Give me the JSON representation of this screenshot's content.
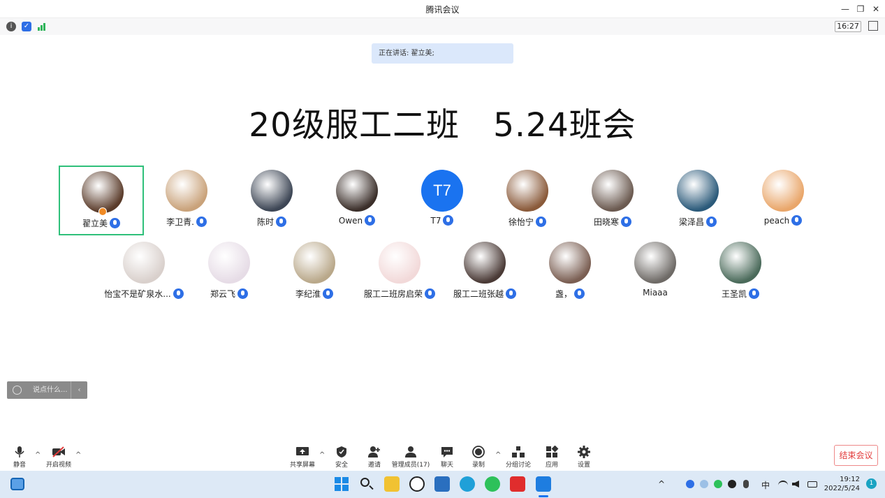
{
  "window": {
    "title": "腾讯会议",
    "minimize": "—",
    "restore": "❐",
    "close": "✕"
  },
  "infobar": {
    "timer": "16:27"
  },
  "speaking": "正在讲话: 翟立美;",
  "meeting_title": "20级服工二班　5.24班会",
  "participants": [
    {
      "name": "翟立美",
      "color": "#5a3b2a"
    },
    {
      "name": "李卫青.",
      "color": "#c9a27a"
    },
    {
      "name": "陈时",
      "color": "#3d4655"
    },
    {
      "name": "Owen",
      "color": "#3b2f2a"
    },
    {
      "name": "T7",
      "avatar_text": "T7",
      "color": "#1a73f0"
    },
    {
      "name": "徐怡宁",
      "color": "#8a5a3a"
    },
    {
      "name": "田晓寒",
      "color": "#6b5a50"
    },
    {
      "name": "梁泽昌",
      "color": "#2b5a7a"
    },
    {
      "name": "peach",
      "color": "#e9a66a"
    },
    {
      "name": "怡宝不是矿泉水...",
      "color": "#d9d0cc"
    },
    {
      "name": "郑云飞",
      "color": "#e6dce6"
    },
    {
      "name": "李纪淮",
      "color": "#b9a88a"
    },
    {
      "name": "服工二班房启荣",
      "color": "#f2d9d9"
    },
    {
      "name": "服工二班张越",
      "color": "#4a3a36"
    },
    {
      "name": "盏，",
      "color": "#7a5e52"
    },
    {
      "name": "Miaaa",
      "color": "#6e6a66"
    },
    {
      "name": "王圣凯",
      "color": "#4a6a5a"
    }
  ],
  "chat": {
    "placeholder": "说点什么...",
    "collapse": "‹"
  },
  "toolbar": {
    "mute": "静音",
    "video": "开启视频",
    "share": "共享屏幕",
    "security": "安全",
    "invite": "邀请",
    "members": "管理成员(17)",
    "chat": "聊天",
    "record": "录制",
    "breakout": "分组讨论",
    "apps": "应用",
    "settings": "设置",
    "end": "结束会议"
  },
  "taskbar": {
    "time": "19:12",
    "date": "2022/5/24",
    "ime": "中",
    "notifications": "1"
  }
}
